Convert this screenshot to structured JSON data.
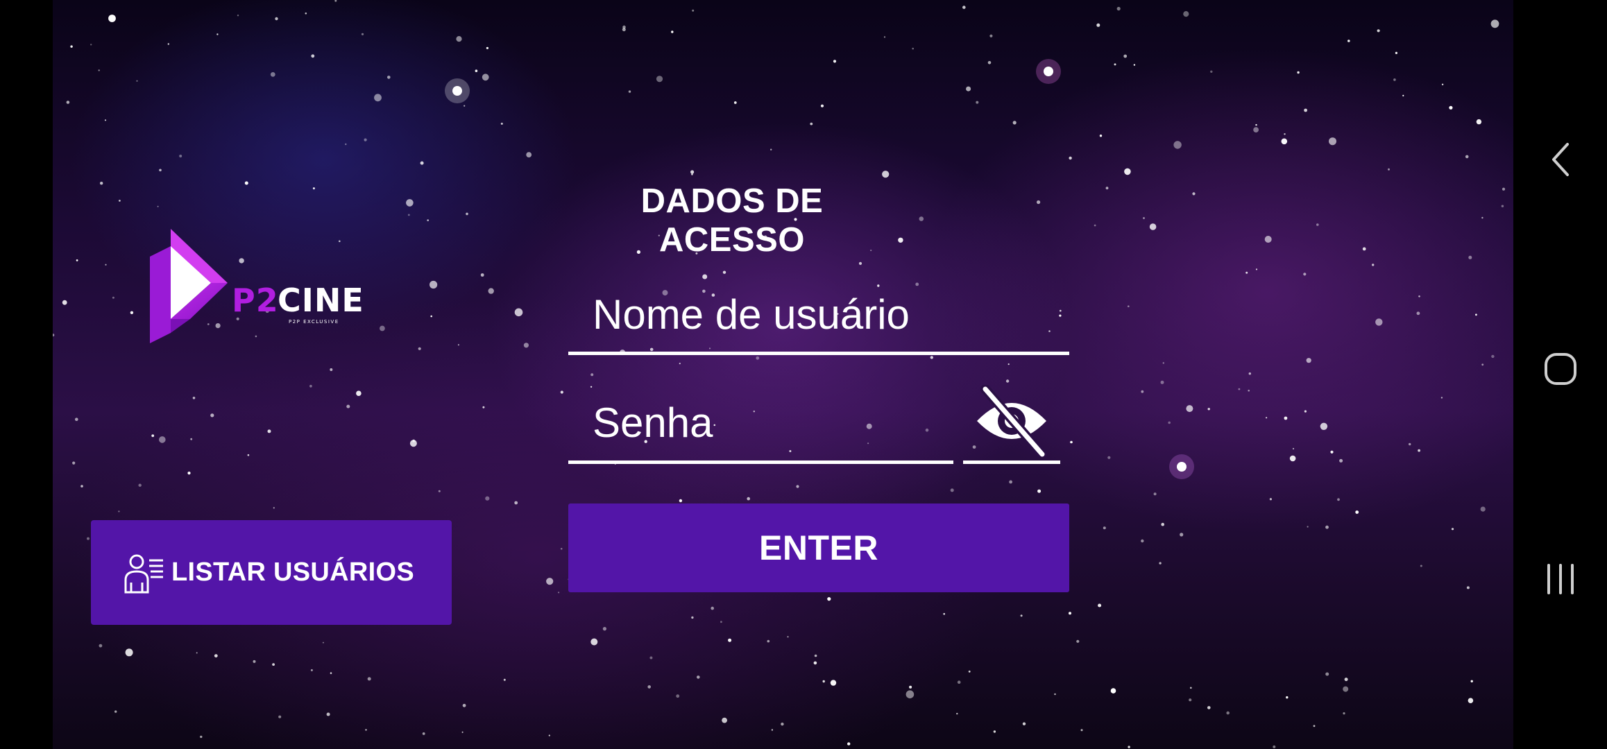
{
  "app": {
    "logo_text": "P2CINE",
    "logo_subtext": "P2P EXCLUSIVE"
  },
  "form": {
    "title": "DADOS DE ACESSO",
    "username_placeholder": "Nome de usuário",
    "password_placeholder": "Senha",
    "enter_label": "ENTER"
  },
  "sidebar": {
    "list_users_label": "LISTAR USUÁRIOS"
  },
  "colors": {
    "button_purple": "#5315a8",
    "logo_magenta": "#b01ee0",
    "text_white": "#ffffff"
  },
  "icons": {
    "list_users": "user-list-icon",
    "password_visibility": "eye-off-icon",
    "nav_back": "back-icon",
    "nav_home": "home-icon",
    "nav_recents": "recents-icon"
  }
}
